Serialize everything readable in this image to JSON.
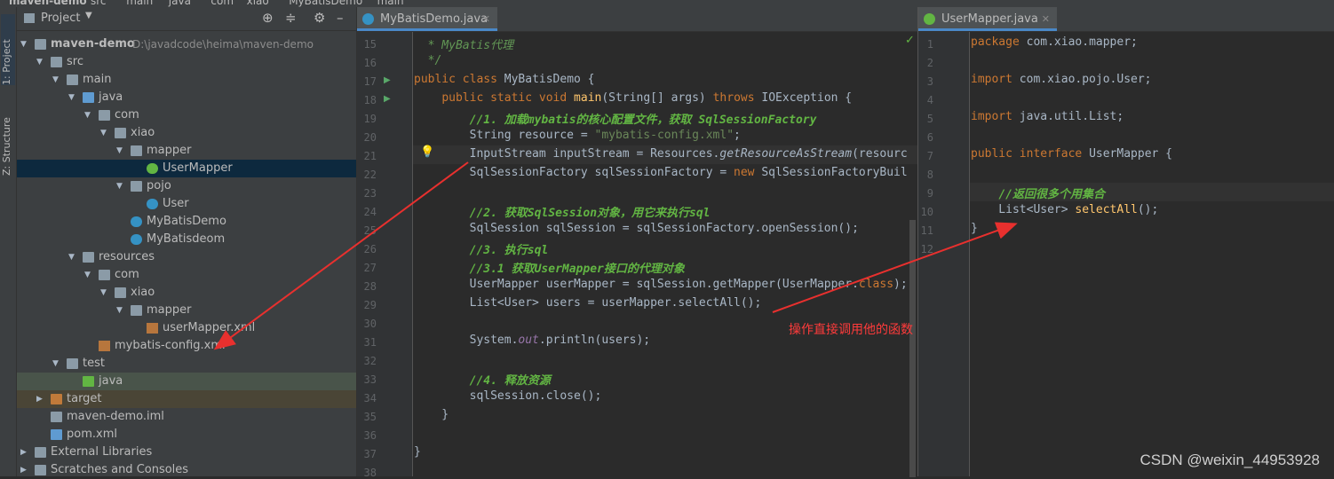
{
  "breadcrumb": [
    "maven-demo",
    "src",
    "main",
    "java",
    "com",
    "xiao",
    "MyBatisDemo",
    "main"
  ],
  "tool_strip": {
    "project_tab": "1: Project",
    "structure_tab": "Z: Structure"
  },
  "project_panel": {
    "title": "Project",
    "tree": [
      {
        "label": "maven-demo",
        "path": "D:\\javadcode\\heima\\maven-demo"
      },
      {
        "label": "src"
      },
      {
        "label": "main"
      },
      {
        "label": "java"
      },
      {
        "label": "com"
      },
      {
        "label": "xiao"
      },
      {
        "label": "mapper"
      },
      {
        "label": "UserMapper"
      },
      {
        "label": "pojo"
      },
      {
        "label": "User"
      },
      {
        "label": "MyBatisDemo"
      },
      {
        "label": "MyBatisdeom"
      },
      {
        "label": "resources"
      },
      {
        "label": "com"
      },
      {
        "label": "xiao"
      },
      {
        "label": "mapper"
      },
      {
        "label": "userMapper.xml"
      },
      {
        "label": "mybatis-config.xml"
      },
      {
        "label": "test"
      },
      {
        "label": "java"
      },
      {
        "label": "target"
      },
      {
        "label": "maven-demo.iml"
      },
      {
        "label": "pom.xml"
      },
      {
        "label": "External Libraries"
      },
      {
        "label": "Scratches and Consoles"
      }
    ]
  },
  "editor_left": {
    "tab": "MyBatisDemo.java",
    "line_numbers": [
      "15",
      "16",
      "17",
      "18",
      "19",
      "20",
      "21",
      "22",
      "23",
      "24",
      "25",
      "26",
      "27",
      "28",
      "29",
      "30",
      "31",
      "32",
      "33",
      "34",
      "35",
      "36",
      "37",
      "38"
    ],
    "lines": [
      "  * MyBatis代理",
      "  */",
      "public class MyBatisDemo {",
      "    public static void main(String[] args) throws IOException {",
      "        //1. 加载mybatis的核心配置文件，获取 SqlSessionFactory",
      "        String resource = \"mybatis-config.xml\";",
      "        InputStream inputStream = Resources.getResourceAsStream(resourc",
      "        SqlSessionFactory sqlSessionFactory = new SqlSessionFactoryBuil",
      "",
      "        //2. 获取SqlSession对象，用它来执行sql",
      "        SqlSession sqlSession = sqlSessionFactory.openSession();",
      "        //3. 执行sql",
      "        //3.1 获取UserMapper接口的代理对象",
      "        UserMapper userMapper = sqlSession.getMapper(UserMapper.class);",
      "        List<User> users = userMapper.selectAll();",
      "",
      "        System.out.println(users);",
      "",
      "        //4. 释放资源",
      "        sqlSession.close();",
      "    }",
      "",
      "}",
      ""
    ]
  },
  "editor_right": {
    "tab": "UserMapper.java",
    "line_numbers": [
      "1",
      "2",
      "3",
      "4",
      "5",
      "6",
      "7",
      "8",
      "9",
      "10",
      "11",
      "12"
    ],
    "lines": [
      "package com.xiao.mapper;",
      "",
      "import com.xiao.pojo.User;",
      "",
      "import java.util.List;",
      "",
      "public interface UserMapper {",
      "",
      "    //返回很多个用集合",
      "    List<User> selectAll();",
      "}",
      ""
    ]
  },
  "annotation": "操作直接调用他的函数",
  "watermark": "CSDN @weixin_44953928",
  "colors": {
    "arrow": "#e8302e",
    "selection": "#0d293e",
    "keyword": "#cc7832",
    "string": "#6a8759",
    "comment": "#629755"
  }
}
